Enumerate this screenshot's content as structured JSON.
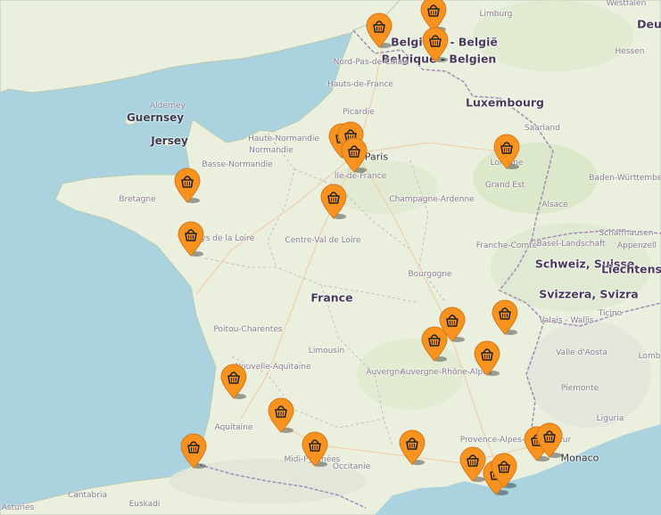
{
  "map": {
    "colors": {
      "sea": "#aad3df",
      "land": "#eaf0dd",
      "marker": "#f7931e",
      "border": "#a58bb7"
    },
    "labels": [
      {
        "id": "germany-label",
        "text": "Deu",
        "cls": "country"
      },
      {
        "id": "westfalen-label",
        "text": "Westfalen",
        "cls": "region"
      },
      {
        "id": "limburg-label",
        "text": "Limburg",
        "cls": "region"
      },
      {
        "id": "hessen-label",
        "text": "Hessen",
        "cls": "region"
      },
      {
        "id": "belgique-label",
        "text": "Belgique - België",
        "cls": "country"
      },
      {
        "id": "belgien-label",
        "text": "Belgique - Belgien",
        "cls": "country"
      },
      {
        "id": "nord-pas-de-calais-label",
        "text": "Nord-Pas-de-Calais",
        "cls": "region"
      },
      {
        "id": "hauts-de-france-label",
        "text": "Hauts-de-France",
        "cls": "region"
      },
      {
        "id": "luxembourg-label",
        "text": "Luxembourg",
        "cls": "country"
      },
      {
        "id": "picardie-label",
        "text": "Picardie",
        "cls": "region"
      },
      {
        "id": "saarland-label",
        "text": "Saarland",
        "cls": "region"
      },
      {
        "id": "guernsey-label",
        "text": "Guernsey",
        "cls": "island"
      },
      {
        "id": "alderney-label",
        "text": "Alderney",
        "cls": "region"
      },
      {
        "id": "jersey-label",
        "text": "Jersey",
        "cls": "island"
      },
      {
        "id": "haute-normandie-label",
        "text": "Haute-Normandie",
        "cls": "region"
      },
      {
        "id": "normandie-label",
        "text": "Normandie",
        "cls": "region"
      },
      {
        "id": "basse-normandie-label",
        "text": "Basse-Normandie",
        "cls": "region"
      },
      {
        "id": "paris-label",
        "text": "Paris",
        "cls": "city"
      },
      {
        "id": "ile-de-france-label",
        "text": "Île-de-France",
        "cls": "region"
      },
      {
        "id": "lorraine-label",
        "text": "Lorraine",
        "cls": "region"
      },
      {
        "id": "grand-est-label",
        "text": "Grand Est",
        "cls": "region"
      },
      {
        "id": "baden-wurttemberg-label",
        "text": "Baden-Württemberg",
        "cls": "region"
      },
      {
        "id": "bretagne-label",
        "text": "Bretagne",
        "cls": "region"
      },
      {
        "id": "champagne-ardenne-label",
        "text": "Champagne-Ardenne",
        "cls": "region"
      },
      {
        "id": "alsace-label",
        "text": "Alsace",
        "cls": "region"
      },
      {
        "id": "pays-de-la-loire-label",
        "text": "Pays de la Loire",
        "cls": "region"
      },
      {
        "id": "centre-val-de-loire-label",
        "text": "Centre-Val de Loire",
        "cls": "region"
      },
      {
        "id": "franche-comte-label",
        "text": "Franche-Comté",
        "cls": "region"
      },
      {
        "id": "basel-label",
        "text": "Basel-Landschaft",
        "cls": "region"
      },
      {
        "id": "schaffhausen-label",
        "text": "Schaffhausen",
        "cls": "region"
      },
      {
        "id": "appenzell-label",
        "text": "Appenzell",
        "cls": "region"
      },
      {
        "id": "schweiz-label",
        "text": "Schweiz, Suisse,",
        "cls": "country"
      },
      {
        "id": "liechtenstein-label",
        "text": "Liechtens",
        "cls": "country"
      },
      {
        "id": "svizzera-label",
        "text": "Svizzera, Svizra",
        "cls": "country"
      },
      {
        "id": "bourgogne-label",
        "text": "Bourgogne",
        "cls": "region"
      },
      {
        "id": "france-label",
        "text": "France",
        "cls": "country"
      },
      {
        "id": "valais-label",
        "text": "Valais - Wallis",
        "cls": "region"
      },
      {
        "id": "ticino-label",
        "text": "Ticino",
        "cls": "region"
      },
      {
        "id": "poitou-charentes-label",
        "text": "Poitou-Charentes",
        "cls": "region"
      },
      {
        "id": "limousin-label",
        "text": "Limousin",
        "cls": "region"
      },
      {
        "id": "valle-d-aosta-label",
        "text": "Valle d'Aosta",
        "cls": "region"
      },
      {
        "id": "lombardia-label",
        "text": "Lomb",
        "cls": "region"
      },
      {
        "id": "nouvelle-aquitaine-label",
        "text": "Nouvelle-Aquitaine",
        "cls": "region"
      },
      {
        "id": "auvergne-label",
        "text": "Auvergne",
        "cls": "region"
      },
      {
        "id": "auvergne-rhone-alpes-label",
        "text": "Auvergne-Rhône-Alpes",
        "cls": "region"
      },
      {
        "id": "piemonte-label",
        "text": "Piemonte",
        "cls": "region"
      },
      {
        "id": "aquitaine-label",
        "text": "Aquitaine",
        "cls": "region"
      },
      {
        "id": "liguria-label",
        "text": "Liguria",
        "cls": "region"
      },
      {
        "id": "midi-pyrenees-label",
        "text": "Midi-Pyrénées",
        "cls": "region"
      },
      {
        "id": "occitanie-label",
        "text": "Occitanie",
        "cls": "region"
      },
      {
        "id": "provence-label",
        "text": "Provence-Alpes-Côte d'Azur",
        "cls": "region"
      },
      {
        "id": "monaco-label",
        "text": "Monaco",
        "cls": "city"
      },
      {
        "id": "cantabria-label",
        "text": "Cantabria",
        "cls": "region"
      },
      {
        "id": "euskadi-label",
        "text": "Euskadi",
        "cls": "region"
      },
      {
        "id": "asturies-label",
        "text": "Asturies",
        "cls": "region"
      }
    ],
    "markers": [
      {
        "id": "marker-lille"
      },
      {
        "id": "marker-brussels"
      },
      {
        "id": "marker-charleroi"
      },
      {
        "id": "marker-rouen"
      },
      {
        "id": "marker-paris-west"
      },
      {
        "id": "marker-paris"
      },
      {
        "id": "marker-metz"
      },
      {
        "id": "marker-rennes"
      },
      {
        "id": "marker-orleans"
      },
      {
        "id": "marker-nantes"
      },
      {
        "id": "marker-lyon"
      },
      {
        "id": "marker-annecy"
      },
      {
        "id": "marker-clermont"
      },
      {
        "id": "marker-grenoble"
      },
      {
        "id": "marker-bordeaux"
      },
      {
        "id": "marker-mont-de-marsan"
      },
      {
        "id": "marker-biarritz"
      },
      {
        "id": "marker-toulouse"
      },
      {
        "id": "marker-montpellier"
      },
      {
        "id": "marker-marseille"
      },
      {
        "id": "marker-toulon"
      },
      {
        "id": "marker-toulon-east"
      },
      {
        "id": "marker-nice"
      },
      {
        "id": "marker-antibes"
      }
    ]
  }
}
